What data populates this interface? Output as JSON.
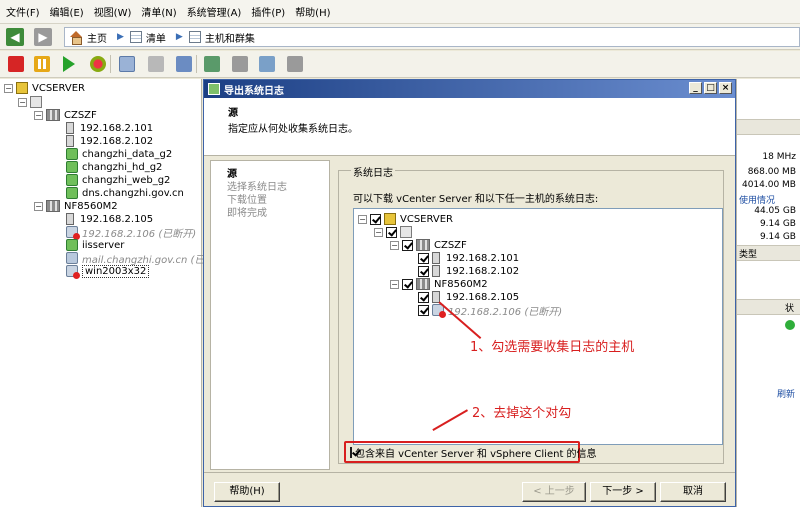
{
  "menu": [
    "文件(F)",
    "编辑(E)",
    "视图(W)",
    "清单(N)",
    "系统管理(A)",
    "插件(P)",
    "帮助(H)"
  ],
  "breadcrumb": {
    "home": "主页",
    "inventory": "清单",
    "hosts_clusters": "主机和群集"
  },
  "tree": {
    "root": "VCSERVER",
    "cluster1": "CZSZF",
    "host1": "192.168.2.101",
    "host2": "192.168.2.102",
    "vm1": "changzhi_data_g2",
    "vm2": "changzhi_hd_g2",
    "vm3": "changzhi_web_g2",
    "vm4": "dns.changzhi.gov.cn",
    "cluster2": "NF8560M2",
    "host3": "192.168.2.105",
    "host4": "192.168.2.106 (已断开)",
    "vm5": "iisserver",
    "vm6": "mail.changzhi.gov.cn (已断开)",
    "vm7": "win2003x32"
  },
  "rightpanel": {
    "cpu": "18 MHz",
    "mem1": "868.00 MB",
    "mem2": "4014.00 MB",
    "usage": "使用情况",
    "s1": "44.05 GB",
    "s2": "9.14 GB",
    "s3": "9.14 GB",
    "type": "类型",
    "status": "状",
    "refresh": "刷新"
  },
  "dialog": {
    "title": "导出系统日志",
    "header_title": "源",
    "header_desc": "指定应从何处收集系统日志。",
    "steps": [
      "源",
      "选择系统日志",
      "下载位置",
      "即将完成"
    ],
    "group_label": "系统日志",
    "desc": "可以下载 vCenter Server 和以下任一主机的系统日志:",
    "tree": {
      "root": "VCSERVER",
      "cluster1": "CZSZF",
      "host1": "192.168.2.101",
      "host2": "192.168.2.102",
      "cluster2": "NF8560M2",
      "host3": "192.168.2.105",
      "host4": "192.168.2.106 (已断开)"
    },
    "include_label": "包含来自 vCenter Server 和 vSphere Client 的信息",
    "buttons": {
      "help": "帮助(H)",
      "back": "< 上一步",
      "next": "下一步 >",
      "cancel": "取消"
    }
  },
  "annotations": {
    "a1": "1、勾选需要收集日志的主机",
    "a2": "2、去掉这个对勾"
  }
}
